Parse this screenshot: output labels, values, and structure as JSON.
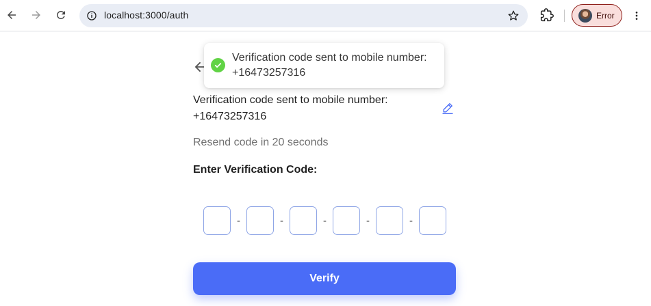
{
  "browser": {
    "url": "localhost:3000/auth",
    "profile_label": "Error",
    "icons": {
      "back": "arrow-left-icon",
      "forward": "arrow-right-icon",
      "reload": "reload-icon",
      "site_info": "info-icon",
      "bookmark": "star-icon",
      "extensions": "puzzle-icon",
      "menu": "kebab-menu-icon"
    },
    "colors": {
      "omnibox_bg": "#e9edf5",
      "profile_bg": "#f9dedc"
    }
  },
  "toast": {
    "icon": "check-circle-icon",
    "line1": "Verification code sent to mobile number:",
    "line2": "+16473257316",
    "color": "#61d345"
  },
  "page": {
    "back_icon": "arrow-left-icon",
    "sent_line1": "Verification code sent to mobile number:",
    "sent_line2": "+16473257316",
    "edit_icon": "pencil-icon",
    "resend_text": "Resend code in 20 seconds",
    "enter_label": "Enter Verification Code:",
    "otp": {
      "digits": [
        "",
        "",
        "",
        "",
        "",
        ""
      ],
      "separator": "-"
    },
    "verify_label": "Verify",
    "colors": {
      "primary": "#4a6cf7",
      "otp_border": "#8fa6e6"
    }
  }
}
